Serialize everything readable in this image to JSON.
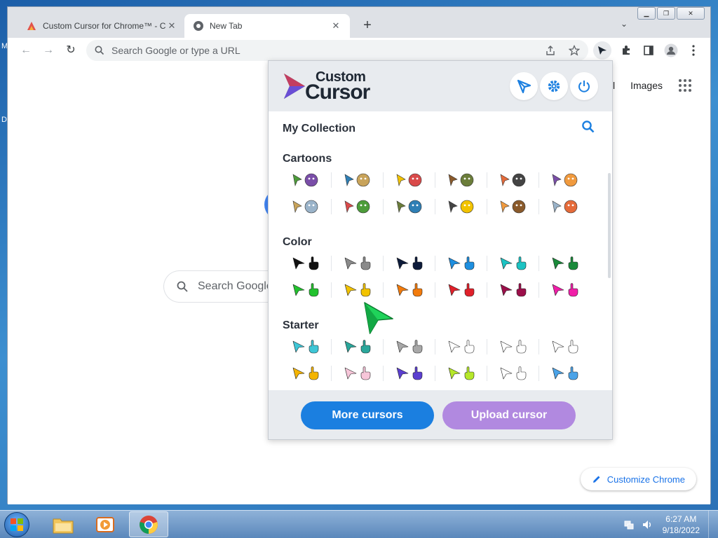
{
  "desktop": {
    "edge_letters": [
      "M",
      "D"
    ]
  },
  "browser": {
    "tabs": [
      {
        "title": "Custom Cursor for Chrome™ - Cl",
        "active": false
      },
      {
        "title": "New Tab",
        "active": true
      }
    ],
    "new_tab_symbol": "+",
    "tab_search_symbol": "⌄",
    "window_controls": [
      "minimize",
      "restore",
      "close"
    ],
    "omnibox_placeholder": "Search Google or type a URL"
  },
  "ntp": {
    "links": [
      "ail",
      "Images"
    ],
    "search_placeholder": "Search Google",
    "customize_label": "Customize Chrome"
  },
  "popup": {
    "brand_line1": "Custom",
    "brand_line2": "Cursor",
    "collection_title": "My Collection",
    "sections": [
      {
        "title": "Cartoons",
        "rows": [
          [
            "sword-turtle",
            "ninja-goblin",
            "minions",
            "cat-cheese",
            "bear-panda",
            "dragon-cat"
          ],
          [
            "shrek-donkey",
            "dog-cat",
            "dragon-black",
            "boy-hero",
            "car-cat",
            "shoe-grinch"
          ]
        ]
      },
      {
        "title": "Color",
        "rows": [
          [
            "#111111",
            "#8a8a8a",
            "#0d1b3a",
            "#1e8fe0",
            "#1cc3c3",
            "#1a8a3a"
          ],
          [
            "#22c22e",
            "#f2c300",
            "#f27b0c",
            "#e0202a",
            "#9c0f4a",
            "#f01ea8"
          ]
        ]
      },
      {
        "title": "Starter",
        "rows": [
          [
            "cyan-arrow",
            "teal-arrow",
            "gray-arrow",
            "crosshair",
            "outline-arrow",
            "outline-hand"
          ],
          [
            "yellow-smile",
            "pastel-arrow",
            "purple-arrow",
            "lime-arrow",
            "yinyang",
            "blue-tool"
          ]
        ]
      }
    ],
    "more_label": "More cursors",
    "upload_label": "Upload cursor",
    "colors": {
      "more": "#1b7fe0",
      "upload": "#b189e0"
    }
  },
  "taskbar": {
    "apps": [
      "file-explorer",
      "media-player",
      "chrome"
    ],
    "time": "6:27 AM",
    "date": "9/18/2022"
  }
}
